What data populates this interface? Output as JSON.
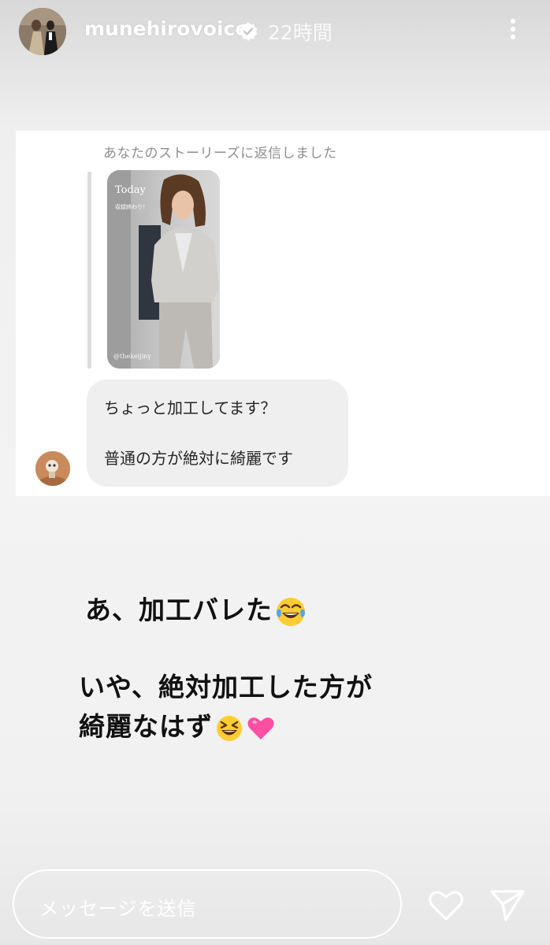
{
  "header": {
    "username": "munehirovoice",
    "time_ago": "22時間",
    "verified": true
  },
  "dm_screenshot": {
    "reply_caption": "あなたのストーリーズに返信しました",
    "story_thumb": {
      "title": "Today",
      "subtitle": "収録終わり！",
      "credit": "@thekeijiny"
    },
    "message_lines": [
      "ちょっと加工してます？",
      "普通の方が絶対に綺麗です"
    ]
  },
  "overlay": {
    "line1": "あ、加工バレた",
    "line2": "いや、絶対加工した方が",
    "line3": "綺麗なはず",
    "emoji_1": "face-with-tears-of-joy",
    "emoji_2": "grinning-squinting-face",
    "emoji_3": "pink-heart"
  },
  "footer": {
    "message_placeholder": "メッセージを送信"
  },
  "colors": {
    "text_dark": "#111111",
    "bubble_bg": "#efefef",
    "caption_gray": "#8e8e8e",
    "heart_pink": "#ff4fa3"
  }
}
